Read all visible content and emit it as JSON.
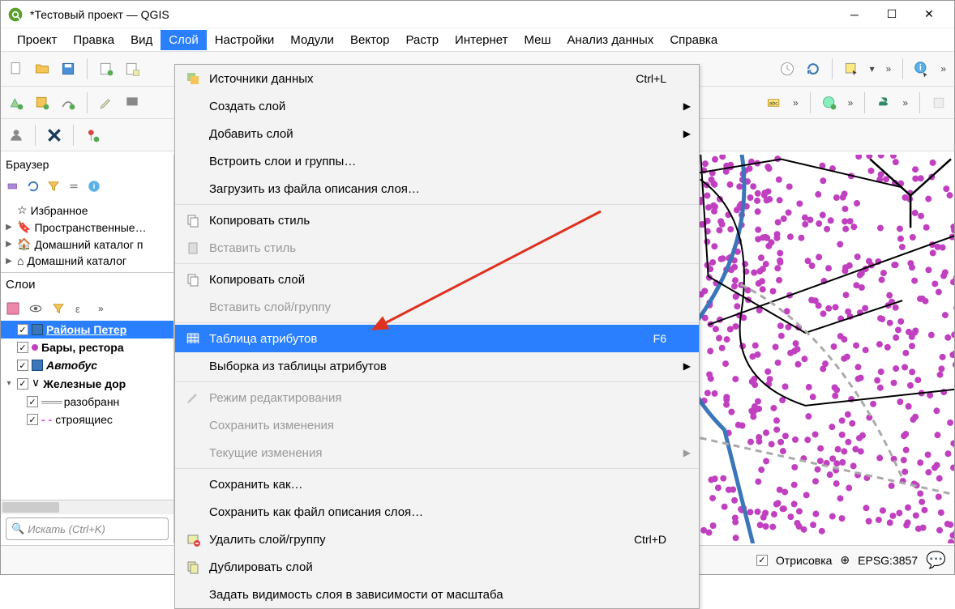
{
  "titlebar": {
    "title": "*Тестовый проект — QGIS"
  },
  "menubar": {
    "items": [
      "Проект",
      "Правка",
      "Вид",
      "Слой",
      "Настройки",
      "Модули",
      "Вектор",
      "Растр",
      "Интернет",
      "Меш",
      "Анализ данных",
      "Справка"
    ],
    "active_index": 3
  },
  "dropdown": {
    "items": [
      {
        "label": "Источники данных",
        "icon": "datasource-icon",
        "shortcut": "Ctrl+L"
      },
      {
        "label": "Создать слой",
        "sub": true
      },
      {
        "label": "Добавить слой",
        "sub": true
      },
      {
        "label": "Встроить слои и группы…"
      },
      {
        "label": "Загрузить из файла описания слоя…"
      },
      {
        "sep": true
      },
      {
        "label": "Копировать стиль",
        "icon": "copy-icon"
      },
      {
        "label": "Вставить стиль",
        "icon": "paste-icon",
        "disabled": true
      },
      {
        "sep": true
      },
      {
        "label": "Копировать слой",
        "icon": "copy-icon"
      },
      {
        "label": "Вставить слой/группу",
        "disabled": true
      },
      {
        "sep": true
      },
      {
        "label": "Таблица атрибутов",
        "icon": "table-icon",
        "shortcut": "F6",
        "highlight": true
      },
      {
        "label": "Выборка из таблицы атрибутов",
        "sub": true
      },
      {
        "sep": true
      },
      {
        "label": "Режим редактирования",
        "icon": "pencil-icon",
        "disabled": true
      },
      {
        "label": "Сохранить изменения",
        "icon": "save-edits-icon",
        "disabled": true
      },
      {
        "label": "Текущие изменения",
        "icon": "current-edits-icon",
        "disabled": true,
        "sub": true
      },
      {
        "sep": true
      },
      {
        "label": "Сохранить как…"
      },
      {
        "label": "Сохранить как файл описания слоя…"
      },
      {
        "label": "Удалить слой/группу",
        "icon": "remove-icon",
        "shortcut": "Ctrl+D"
      },
      {
        "label": "Дублировать слой",
        "icon": "duplicate-icon"
      },
      {
        "label": "Задать видимость слоя в зависимости от масштаба"
      }
    ]
  },
  "browser": {
    "title": "Браузер",
    "items": [
      {
        "icon": "star-icon",
        "label": "Избранное"
      },
      {
        "icon": "bookmark-icon",
        "label": "Пространственные…",
        "expander": "▶"
      },
      {
        "icon": "home-icon",
        "label": "Домашний каталог п",
        "expander": "▶"
      },
      {
        "icon": "home-icon",
        "label": "Домашний каталог",
        "expander": "▶"
      }
    ]
  },
  "layers": {
    "title": "Слои",
    "items": [
      {
        "checked": true,
        "label": "Районы Петер",
        "selected": true,
        "sym": "blue"
      },
      {
        "checked": true,
        "label": "Бары, рестора",
        "sym": "mag"
      },
      {
        "checked": true,
        "label": "Автобус",
        "italic": true,
        "sym": "blue"
      },
      {
        "checked": true,
        "label": "Железные дор",
        "expander": "▾",
        "sym": "line"
      },
      {
        "checked": true,
        "label": "разобранн",
        "indent": true,
        "sym": "rail"
      },
      {
        "checked": true,
        "label": "строящиес",
        "indent": true,
        "sym": "dash"
      }
    ]
  },
  "search": {
    "placeholder": "Искать (Ctrl+K)"
  },
  "statusbar": {
    "render_chk": true,
    "render_label": "Отрисовка",
    "crs_label": "EPSG:3857"
  }
}
